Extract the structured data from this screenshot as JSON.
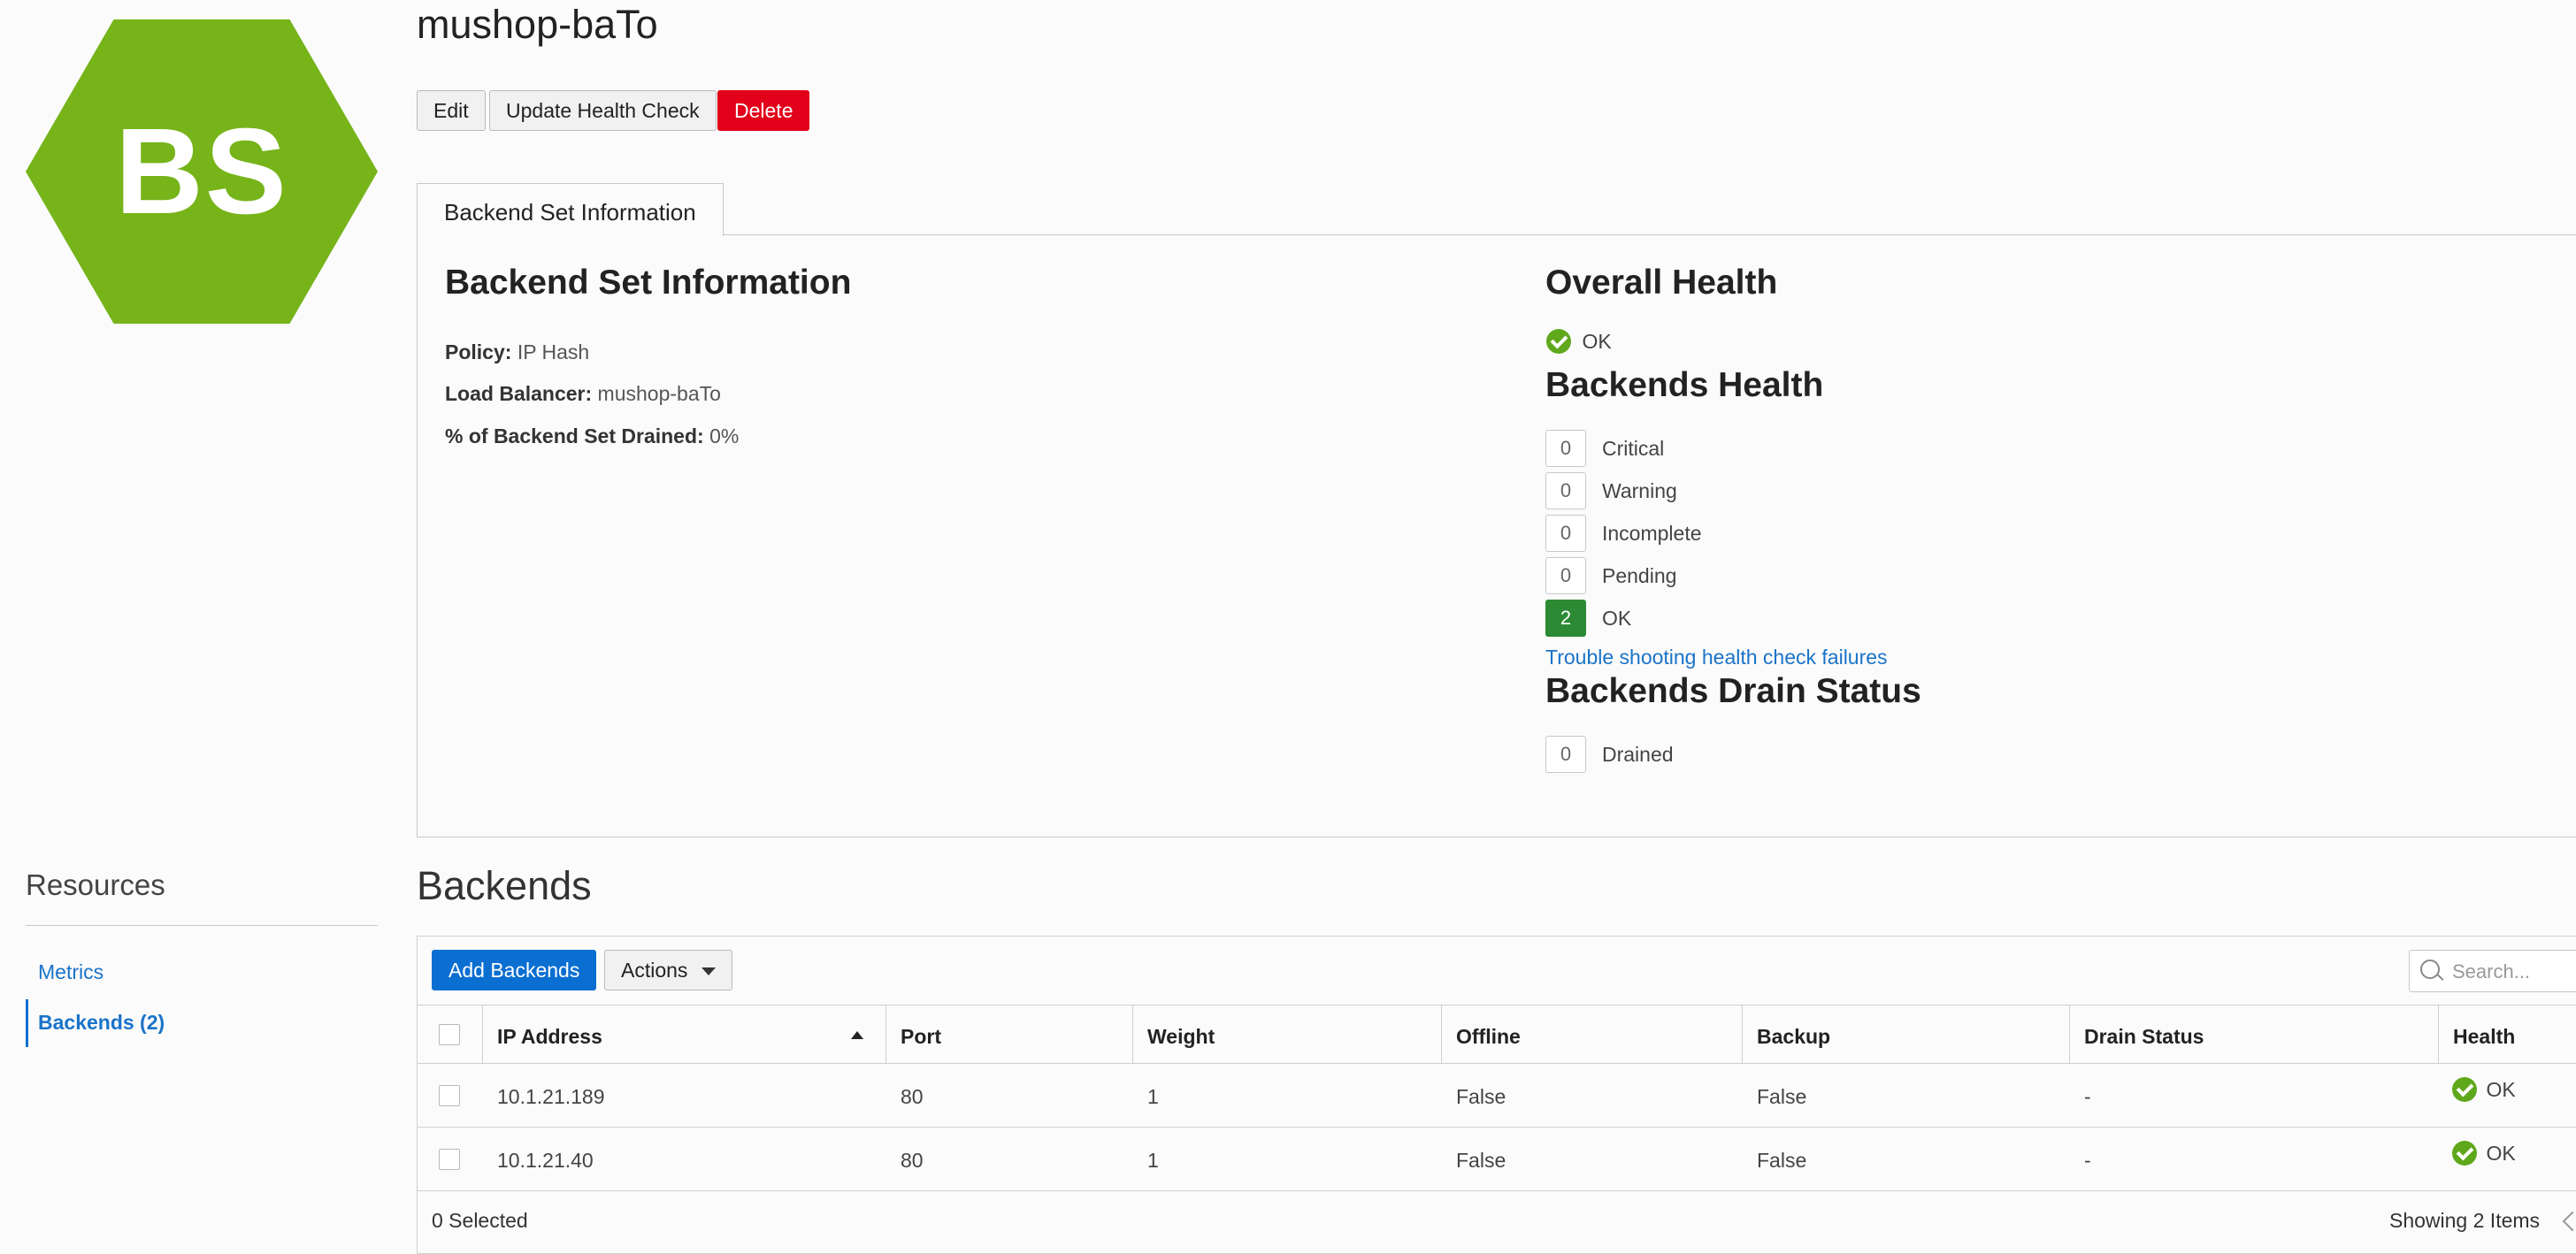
{
  "colors": {
    "hex_badge": "#76b41a",
    "primary": "#0b6ed1",
    "danger": "#e2001a",
    "ok_green": "#2c8a35",
    "ok_icon": "#5fa81c",
    "link": "#1a73c9"
  },
  "badge": {
    "initials": "BS",
    "icon": "backend-set-hexagon"
  },
  "header": {
    "title": "mushop-baTo"
  },
  "toolbar": {
    "edit_label": "Edit",
    "update_health_label": "Update Health Check",
    "delete_label": "Delete"
  },
  "tabs": [
    {
      "label": "Backend Set Information"
    }
  ],
  "info": {
    "heading": "Backend Set Information",
    "policy_label": "Policy:",
    "policy_value": "IP Hash",
    "lb_label": "Load Balancer:",
    "lb_value": "mushop-baTo",
    "drained_label": "% of Backend Set Drained:",
    "drained_value": "0%"
  },
  "health": {
    "overall_heading": "Overall Health",
    "overall_status": "OK",
    "backends_heading": "Backends Health",
    "counts": [
      {
        "count": "0",
        "label": "Critical"
      },
      {
        "count": "0",
        "label": "Warning"
      },
      {
        "count": "0",
        "label": "Incomplete"
      },
      {
        "count": "0",
        "label": "Pending"
      },
      {
        "count": "2",
        "label": "OK"
      }
    ],
    "trouble_link": "Trouble shooting health check failures",
    "drain_heading": "Backends Drain Status",
    "drain_count": "0",
    "drain_label": "Drained"
  },
  "resources": {
    "title": "Resources",
    "items": [
      {
        "label": "Metrics"
      },
      {
        "label": "Backends (2)"
      }
    ]
  },
  "backends": {
    "title": "Backends",
    "add_label": "Add Backends",
    "actions_label": "Actions",
    "search_placeholder": "Search...",
    "columns": [
      "IP Address",
      "Port",
      "Weight",
      "Offline",
      "Backup",
      "Drain Status",
      "Health"
    ],
    "rows": [
      {
        "ip": "10.1.21.189",
        "port": "80",
        "weight": "1",
        "offline": "False",
        "backup": "False",
        "drain": "-",
        "health": "OK"
      },
      {
        "ip": "10.1.21.40",
        "port": "80",
        "weight": "1",
        "offline": "False",
        "backup": "False",
        "drain": "-",
        "health": "OK"
      }
    ],
    "selected_text": "0 Selected",
    "showing_text": "Showing 2 Items"
  }
}
